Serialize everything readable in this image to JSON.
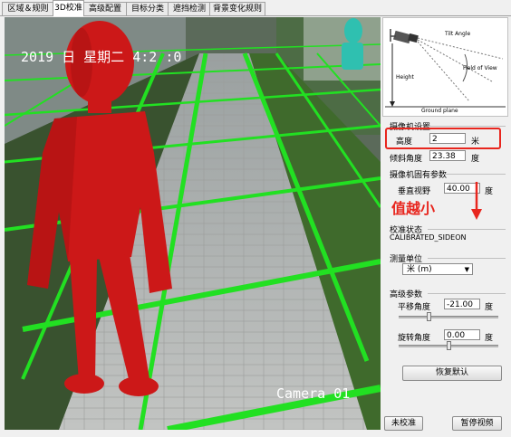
{
  "tabs": [
    "区域＆规则",
    "3D校准",
    "高级配置",
    "目标分类",
    "遮挡检测",
    "背景变化规则"
  ],
  "video": {
    "timestamp": "2019 日 星期二 4:2 :0",
    "camera_label": "Camera 01"
  },
  "diagram": {
    "tilt_angle_label": "Tilt Angle",
    "field_of_view_label": "Field of View",
    "height_label": "Height",
    "ground_plane_label": "Ground plane"
  },
  "camera_settings": {
    "title": "摄像机设置",
    "height_label": "高度",
    "height_value": "2",
    "height_unit": "米",
    "tilt_label": "倾斜角度",
    "tilt_value": "23.38",
    "tilt_unit": "度"
  },
  "intrinsics": {
    "title": "摄像机固有参数",
    "fov_label": "垂直视野",
    "fov_value": "40.00",
    "fov_unit": "度"
  },
  "annotation": {
    "text": "值越小",
    "color": "#e8261e"
  },
  "calibration": {
    "title": "校准状态",
    "status": "CALIBRATED_SIDEON"
  },
  "measurement": {
    "title": "测量单位",
    "selected": "米 (m)"
  },
  "advanced": {
    "title": "高级参数",
    "pan_label": "平移角度",
    "pan_value": "-21.00",
    "pan_unit": "度",
    "pan_slider": 0.3,
    "roll_label": "旋转角度",
    "roll_value": "0.00",
    "roll_unit": "度",
    "roll_slider": 0.5
  },
  "buttons": {
    "restore_default": "恢复默认",
    "not_calibrated": "未校准",
    "pause_video": "暂停视频"
  },
  "colors": {
    "grid_green": "#22e022",
    "figure_red": "#cc1818",
    "highlight_red": "#e8261e"
  }
}
